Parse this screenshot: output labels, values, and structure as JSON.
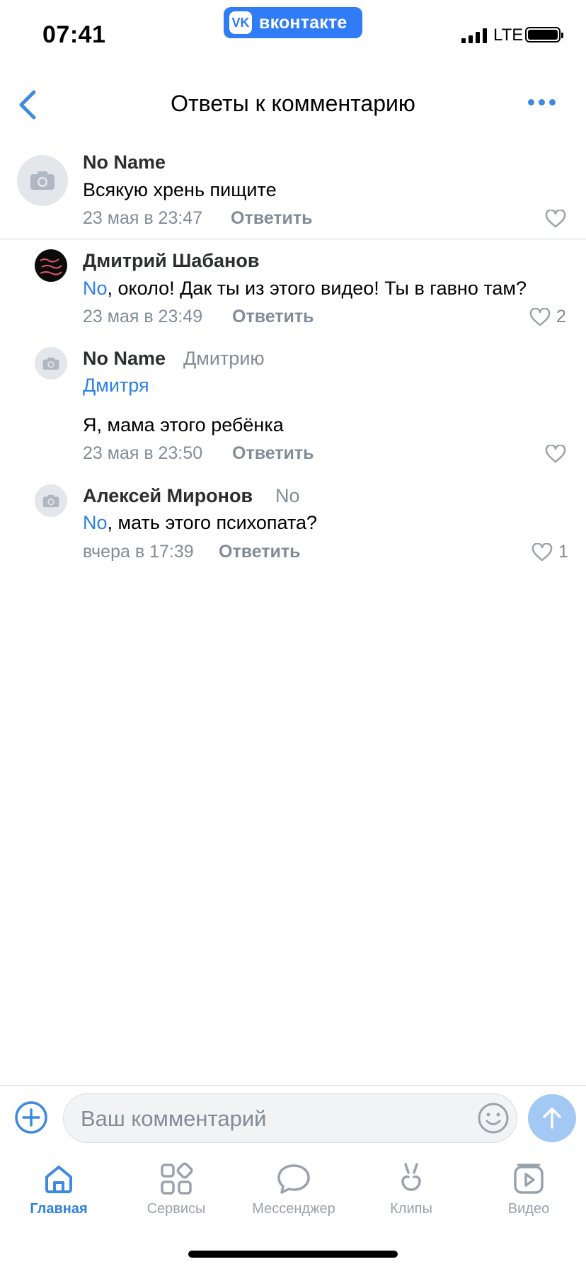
{
  "status_bar": {
    "time": "07:41",
    "network": "LTE"
  },
  "brand": {
    "logo_text": "VK",
    "name": "вконтакте",
    "color": "#2f7cf6"
  },
  "header": {
    "title": "Ответы к комментарию",
    "back_icon": "chevron-left-icon",
    "more_icon": "more-dots-icon"
  },
  "comments": [
    {
      "name": "No Name",
      "text": "Всякую хрень пищите",
      "date": "23 мая в 23:47",
      "reply": "Ответить",
      "likes": "",
      "avatar": "camera-placeholder"
    },
    {
      "name": "Дмитрий Шабанов",
      "mention": "No",
      "text": ", около! Дак ты из этого видео! Ты в гавно там?",
      "date": "23 мая в 23:49",
      "reply": "Ответить",
      "likes": "2",
      "avatar": "custom-image"
    },
    {
      "name": "No Name",
      "addressee": "Дмитрию",
      "mention": "Дмитря",
      "text": "Я, мама этого ребёнка",
      "date": "23 мая в 23:50",
      "reply": "Ответить",
      "likes": "",
      "avatar": "camera-placeholder"
    },
    {
      "name": "Алексей Миронов",
      "addressee": "No",
      "mention": "No",
      "text": ", мать этого психопата?",
      "date": "вчера в 17:39",
      "reply": "Ответить",
      "likes": "1",
      "avatar": "camera-placeholder"
    }
  ],
  "composer": {
    "placeholder": "Ваш комментарий",
    "value": ""
  },
  "tabs": [
    {
      "label": "Главная",
      "icon": "home-icon",
      "active": true
    },
    {
      "label": "Сервисы",
      "icon": "services-icon",
      "active": false
    },
    {
      "label": "Мессенджер",
      "icon": "messenger-icon",
      "active": false
    },
    {
      "label": "Клипы",
      "icon": "clips-icon",
      "active": false
    },
    {
      "label": "Видео",
      "icon": "video-icon",
      "active": false
    }
  ],
  "colors": {
    "accent": "#2d81e0",
    "secondary_text": "#818c99",
    "send_button": "#a3c8f4"
  }
}
